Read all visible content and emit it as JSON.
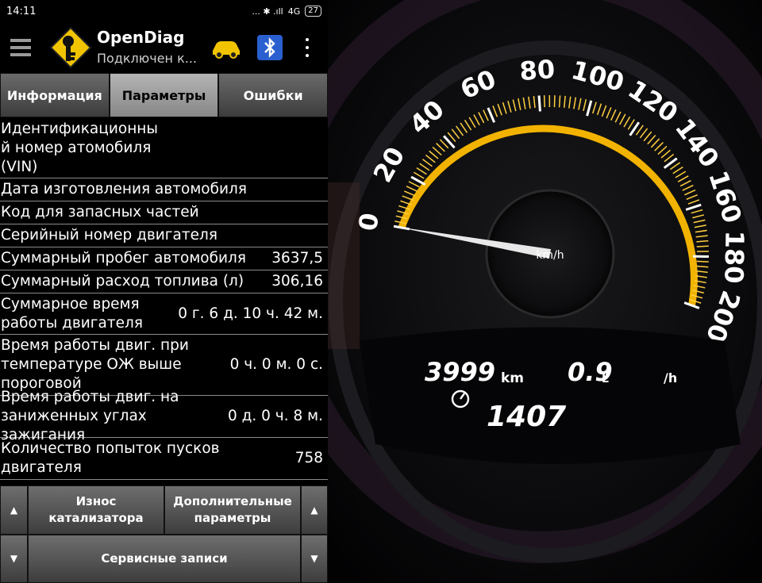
{
  "status_bar": {
    "time": "14:11",
    "indicators": "... ✱ .ıll",
    "network": "4G",
    "battery": "27"
  },
  "app": {
    "title": "OpenDiag",
    "subtitle": "Подключен к..."
  },
  "icons": {
    "menu": "menu-icon",
    "logo": "opendiag-key-icon",
    "car": "car-icon",
    "bluetooth": "bluetooth-icon",
    "more": "more-vert-icon"
  },
  "tabs": [
    {
      "label": "Информация",
      "active": false
    },
    {
      "label": "Параметры",
      "active": true
    },
    {
      "label": "Ошибки",
      "active": false
    }
  ],
  "params": [
    {
      "label": "Идентификационны\nй номер атомобиля\n(VIN)",
      "value": ""
    },
    {
      "label": "Дата изготовления автомобиля",
      "value": ""
    },
    {
      "label": "Код для запасных частей",
      "value": ""
    },
    {
      "label": "Серийный номер двигателя",
      "value": ""
    },
    {
      "label": "Суммарный пробег автомобиля",
      "value": "3637,5"
    },
    {
      "label": "Суммарный расход топлива (л)",
      "value": "306,16"
    },
    {
      "label": "Суммарное время\nработы двигателя",
      "value": "0 г. 6 д. 10 ч. 42 м."
    },
    {
      "label": "Время работы двиг. при\nтемпературе ОЖ выше\nпороговой",
      "value": "0 ч. 0 м. 0 с."
    },
    {
      "label": "Время работы двиг. на\nзаниженных углах зажигания",
      "value": "0 д. 0 ч. 8 м."
    },
    {
      "label": "Количество попыток пусков\nдвигателя",
      "value": "758"
    }
  ],
  "buttons": {
    "catalyst": "Износ\nкатализатора",
    "extra": "Дополнительные\nпараметры",
    "service": "Сервисные записи",
    "up": "▲",
    "down": "▼"
  },
  "dashboard": {
    "speed_labels": [
      "0",
      "20",
      "40",
      "60",
      "80",
      "100",
      "120",
      "140",
      "160",
      "180",
      "200"
    ],
    "unit": "km/h",
    "odometer": "3999",
    "odometer_unit": "km",
    "consumption": "0.9",
    "consumption_unit_l": "L",
    "consumption_unit_h": "/h",
    "trip": "1407",
    "speed_value": 0,
    "colors": {
      "arc": "#f2b300",
      "needle": "#ffffff"
    }
  }
}
